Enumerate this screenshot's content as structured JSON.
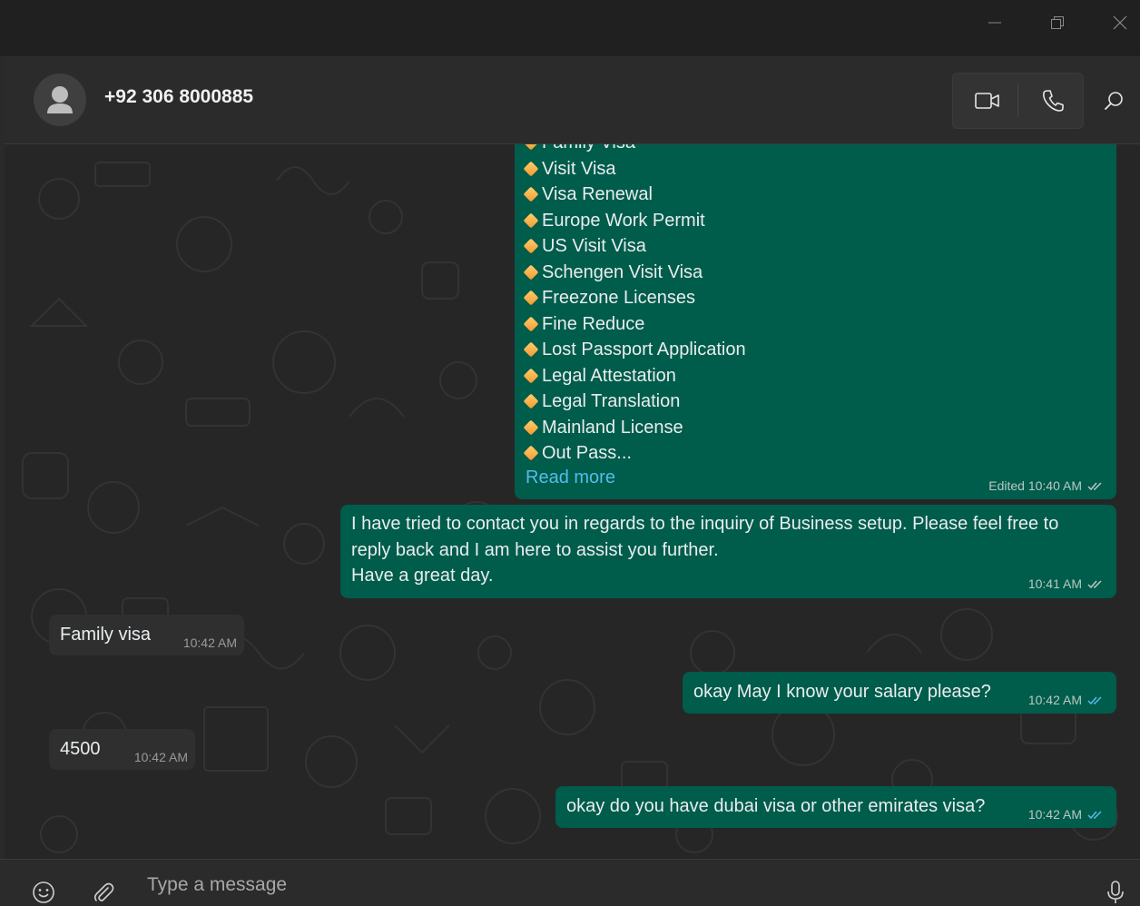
{
  "window": {
    "minimize_icon": "minimize-icon",
    "restore_icon": "restore-icon",
    "close_icon": "close-icon"
  },
  "header": {
    "contact_name": "+92 306 8000885",
    "avatar_icon": "person-icon",
    "video_icon": "video-camera-icon",
    "call_icon": "phone-icon",
    "search_icon": "search-icon"
  },
  "colors": {
    "outgoing_bubble": "#005c4b",
    "incoming_bubble": "#2f2f2f",
    "read_ticks": "#53bdeb",
    "link": "#53bdeb"
  },
  "messages": {
    "services": {
      "partial_top": "Family Visa",
      "items": [
        "Visit Visa",
        "Visa Renewal",
        "Europe Work Permit",
        "US Visit Visa",
        "Schengen Visit Visa",
        "Freezone Licenses",
        "Fine Reduce",
        "Lost Passport Application",
        "Legal Attestation",
        "Legal Translation",
        "Mainland License",
        "Out Pass..."
      ],
      "read_more": "Read more",
      "time": "Edited 10:40 AM"
    },
    "business_followup": {
      "line1": "I have  tried to contact you in regards to the inquiry of Business setup. Please feel free to",
      "line2": "reply back and I am here to assist you further.",
      "line3": "Have a great day.",
      "time": "10:41 AM"
    },
    "family_visa": {
      "text": "Family visa",
      "time": "10:42 AM"
    },
    "salary_question": {
      "text": "okay May I know your salary please?",
      "time": "10:42 AM"
    },
    "salary_answer": {
      "text": "4500",
      "time": "10:42 AM"
    },
    "visa_question": {
      "text": "okay do you have dubai visa or other emirates visa?",
      "time": "10:42 AM"
    }
  },
  "composer": {
    "placeholder": "Type a message",
    "emoji_icon": "emoji-icon",
    "attach_icon": "paperclip-icon",
    "mic_icon": "microphone-icon"
  }
}
